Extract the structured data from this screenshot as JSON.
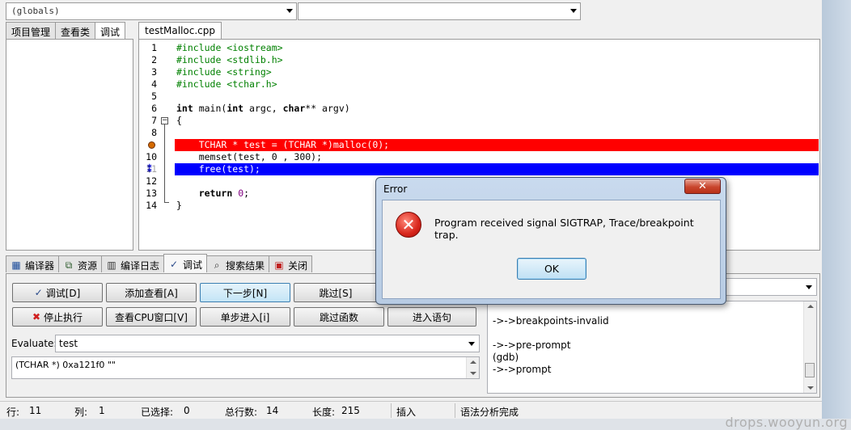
{
  "toolbar": {
    "globals_combo": "(globals)",
    "member_combo": ""
  },
  "left_tabs": [
    "项目管理",
    "查看类",
    "调试"
  ],
  "editor": {
    "tab": "testMalloc.cpp",
    "lines": [
      {
        "n": "1",
        "text": "#include <iostream>"
      },
      {
        "n": "2",
        "text": "#include <stdlib.h>"
      },
      {
        "n": "3",
        "text": "#include <string>"
      },
      {
        "n": "4",
        "text": "#include <tchar.h>"
      },
      {
        "n": "5",
        "text": ""
      },
      {
        "n": "6",
        "text": "int main(int argc, char** argv)"
      },
      {
        "n": "7",
        "text": "{"
      },
      {
        "n": "8",
        "text": ""
      },
      {
        "n": "9",
        "text": "    TCHAR * test = (TCHAR *)malloc(0);"
      },
      {
        "n": "10",
        "text": "    memset(test, 0 , 300);"
      },
      {
        "n": "11",
        "text": "    free(test);"
      },
      {
        "n": "12",
        "text": ""
      },
      {
        "n": "13",
        "text": "    return 0;"
      },
      {
        "n": "14",
        "text": "}"
      }
    ],
    "breakpoint_line": 9,
    "current_line": 11,
    "breakpoint_color": "#ff0000",
    "current_color": "#0000ff"
  },
  "bottom_tabs": [
    {
      "label": "编译器",
      "icon": "compiler-icon"
    },
    {
      "label": "资源",
      "icon": "resources-icon"
    },
    {
      "label": "编译日志",
      "icon": "compile-log-icon"
    },
    {
      "label": "调试",
      "icon": "debug-check-icon"
    },
    {
      "label": "搜索结果",
      "icon": "search-results-icon"
    },
    {
      "label": "关闭",
      "icon": "close-tab-icon"
    }
  ],
  "debug": {
    "buttons_row1": [
      "调试[D]",
      "添加查看[A]",
      "下一步[N]",
      "跳过[S]"
    ],
    "buttons_row2": [
      "停止执行",
      "查看CPU窗口[V]",
      "单步进入[i]",
      "跳过函数",
      "进入语句"
    ],
    "evaluate_label": "Evaluate:",
    "evaluate_value": "test",
    "result": "(TCHAR *) 0xa121f0 \"\"",
    "gdb_output": [
      "->->breakpoints-invalid",
      "",
      "->->pre-prompt",
      "(gdb)",
      "->->prompt"
    ]
  },
  "statusbar": {
    "row_label": "行:",
    "row_value": "11",
    "col_label": "列:",
    "col_value": "1",
    "sel_label": "已选择:",
    "sel_value": "0",
    "total_label": "总行数:",
    "total_value": "14",
    "len_label": "长度:",
    "len_value": "215",
    "mode": "插入",
    "parse_status": "语法分析完成"
  },
  "dialog": {
    "title": "Error",
    "close": "✕",
    "message": "Program received signal SIGTRAP, Trace/breakpoint trap.",
    "ok": "OK"
  },
  "watermark": "drops.wooyun.org"
}
